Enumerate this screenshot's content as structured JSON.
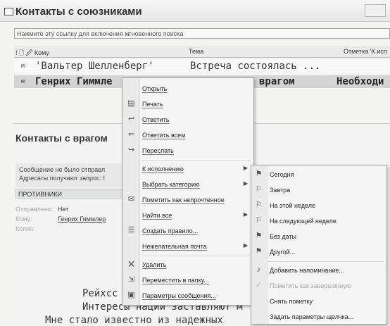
{
  "window": {
    "title": "Контакты с союзниками",
    "search_placeholder": "Нажмите эту ссылку для включения мгновенного поиска"
  },
  "columns": {
    "flags": "! 🗋 🖉 Кому",
    "subject": "Тема",
    "due": "Отметка 'К исп"
  },
  "messages": [
    {
      "to": "'Вальтер Шелленберг'",
      "subject": "Встреча состоялась ..."
    },
    {
      "to": "Генрих Гиммле",
      "subject": "врагом",
      "extra": "Необходи"
    }
  ],
  "preview": {
    "title": "Контакты с врагом",
    "info_line1": "Сообщение не было отправл",
    "info_line2": "Адресаты получают запрос: I",
    "tab": "ПРОТИВНИКИ",
    "from_label": "Отправлено:",
    "from_value": "Нет",
    "to_label": "Кому:",
    "to_value": "Генрих Гиммлер",
    "copy_label": "Копия:",
    "body_line1": "Рейхсс",
    "body_line2": "Интересы нации заставляют м",
    "body_line3": "Мне стало известно из надежных"
  },
  "context_menu": {
    "items": [
      {
        "label": "Открыть",
        "icon": "",
        "sub": false
      },
      {
        "label": "Печать",
        "icon": "print-icon",
        "sub": false
      },
      {
        "label": "Ответить",
        "icon": "reply-icon",
        "sub": false
      },
      {
        "label": "Ответить всем",
        "icon": "reply-all-icon",
        "sub": false
      },
      {
        "label": "Переслать",
        "icon": "forward-icon",
        "sub": false
      },
      {
        "label": "К исполнению",
        "icon": "",
        "sub": true
      },
      {
        "label": "Выбрать категорию",
        "icon": "",
        "sub": true
      },
      {
        "label": "Пометить как непрочтенное",
        "icon": "envelope-icon",
        "sub": false
      },
      {
        "label": "Найти все",
        "icon": "",
        "sub": true
      },
      {
        "label": "Создать правило...",
        "icon": "rule-icon",
        "sub": false
      },
      {
        "label": "Нежелательная почта",
        "icon": "",
        "sub": true
      },
      {
        "label": "Удалить",
        "icon": "delete-icon",
        "sub": false
      },
      {
        "label": "Переместить в папку...",
        "icon": "move-folder-icon",
        "sub": false
      },
      {
        "label": "Параметры сообщения...",
        "icon": "options-icon",
        "sub": false
      }
    ]
  },
  "submenu": {
    "items": [
      {
        "label": "Сегодня",
        "icon": "flag-icon"
      },
      {
        "label": "Завтра",
        "icon": "flag-icon"
      },
      {
        "label": "На этой неделе",
        "icon": "flag-icon"
      },
      {
        "label": "На следующей неделе",
        "icon": "flag-icon"
      },
      {
        "label": "Без даты",
        "icon": "flag-icon"
      },
      {
        "label": "Другой...",
        "icon": "flag-icon"
      },
      {
        "label": "Добавить напоминание...",
        "icon": "bell-icon"
      },
      {
        "label": "Пометить как завершенную",
        "icon": "check-icon",
        "disabled": true
      },
      {
        "label": "Снять пометку",
        "icon": ""
      },
      {
        "label": "Задать параметры щелчка...",
        "icon": ""
      }
    ]
  }
}
